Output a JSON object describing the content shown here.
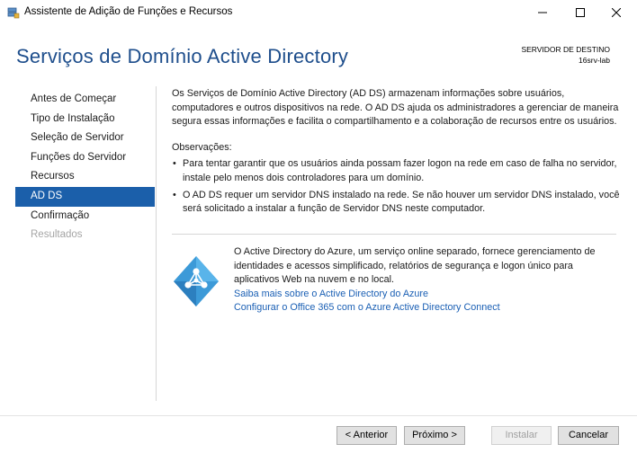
{
  "window": {
    "title": "Assistente de Adição de Funções e Recursos",
    "icon": "server-manager-icon"
  },
  "header": {
    "title": "Serviços de Domínio Active Directory",
    "dest_label": "SERVIDOR DE DESTINO",
    "dest_server": "16srv-lab"
  },
  "nav": {
    "items": [
      {
        "label": "Antes de Começar",
        "state": "normal"
      },
      {
        "label": "Tipo de Instalação",
        "state": "normal"
      },
      {
        "label": "Seleção de Servidor",
        "state": "normal"
      },
      {
        "label": "Funções do Servidor",
        "state": "normal"
      },
      {
        "label": "Recursos",
        "state": "normal"
      },
      {
        "label": "AD DS",
        "state": "active"
      },
      {
        "label": "Confirmação",
        "state": "normal"
      },
      {
        "label": "Resultados",
        "state": "disabled"
      }
    ]
  },
  "content": {
    "intro": "Os Serviços de Domínio Active Directory (AD DS) armazenam informações sobre usuários, computadores e outros dispositivos na rede. O AD DS ajuda os administradores a gerenciar de maneira segura essas informações e facilita o compartilhamento e a colaboração de recursos entre os usuários.",
    "obs_title": "Observações:",
    "bullets": [
      "Para tentar garantir que os usuários ainda possam fazer logon na rede em caso de falha no servidor, instale pelo menos dois controladores para um domínio.",
      "O AD DS requer um servidor DNS instalado na rede. Se não houver um servidor DNS instalado, você será solicitado a instalar a função de Servidor DNS neste computador."
    ]
  },
  "azure": {
    "icon": "azure-ad-icon",
    "text": "O Active Directory do Azure, um serviço online separado, fornece gerenciamento de identidades e acessos simplificado, relatórios de segurança e logon único para aplicativos Web na nuvem e no local.",
    "link1": "Saiba mais sobre o Active Directory do Azure",
    "link2": "Configurar o Office 365 com o Azure Active Directory Connect"
  },
  "buttons": {
    "prev": "< Anterior",
    "next": "Próximo >",
    "install": "Instalar",
    "cancel": "Cancelar"
  },
  "colors": {
    "title": "#1e4e8c",
    "active_nav": "#1b5faa",
    "link": "#1a5fb4",
    "azure": "#3c9ad8"
  }
}
